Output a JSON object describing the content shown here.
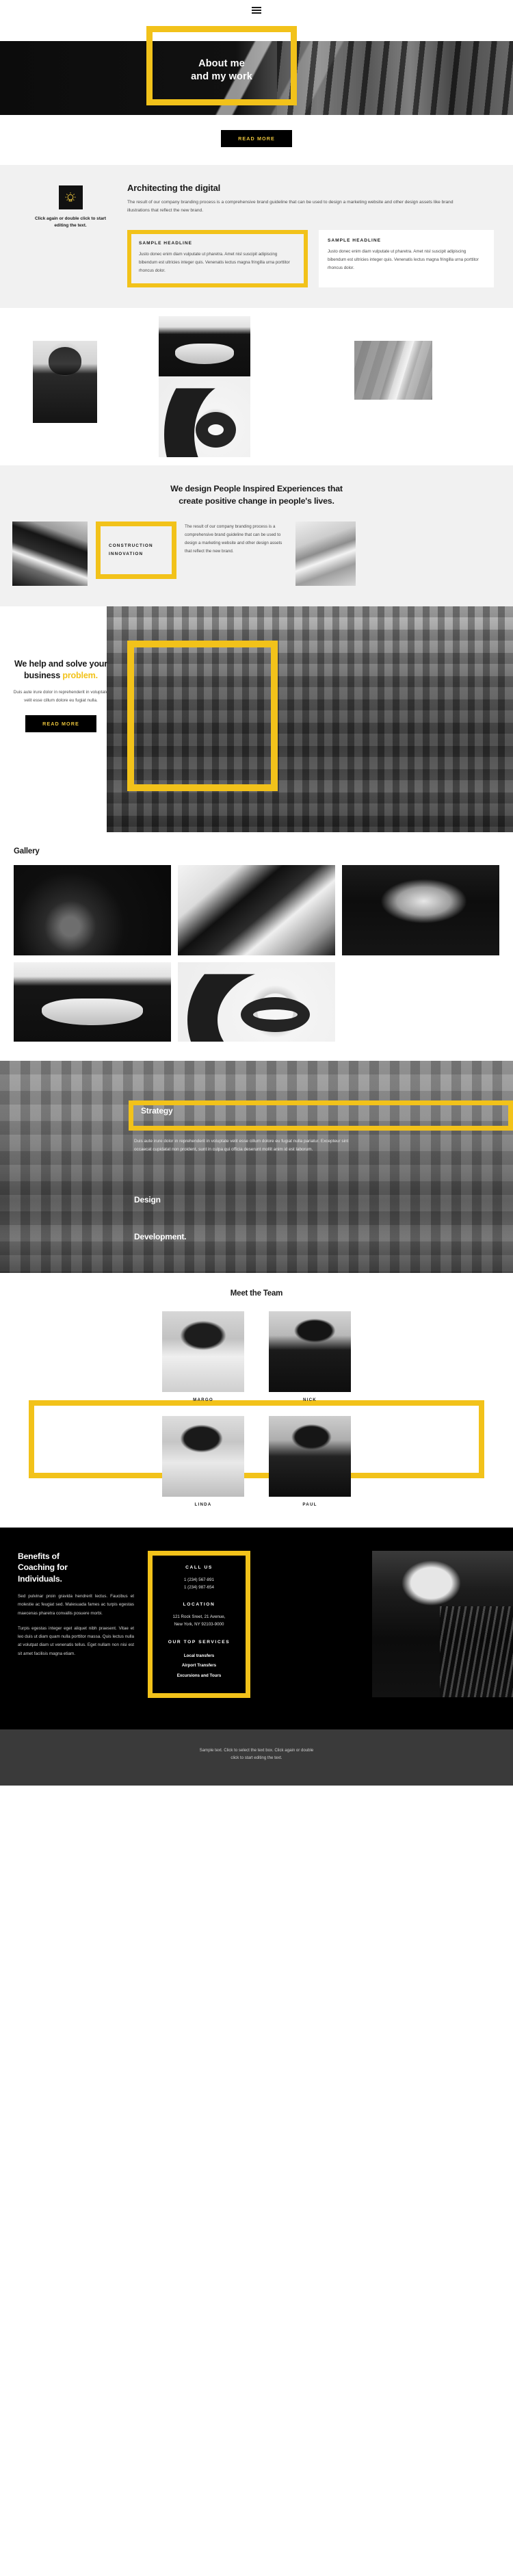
{
  "nav": {
    "menu_icon": "hamburger-menu-icon"
  },
  "hero": {
    "title_line1": "About me",
    "title_line2": "and my work"
  },
  "read_more": {
    "label": "READ MORE"
  },
  "architecting": {
    "icon": "lightbulb-icon",
    "note": "Click again or double click to start editing the text.",
    "heading": "Architecting the digital",
    "paragraph": "The result of our company branding process is a comprehensive brand guideline that can be used to design a marketing website and other design assets like brand illustrations that reflect the new brand.",
    "cards": [
      {
        "headline": "SAMPLE HEADLINE",
        "body": "Justo donec enim diam vulputate ut pharetra. Amet nisl suscipit adipiscing bibendum est ultricies integer quis. Venenatis lectus magna fringilla urna porttitor rhoncus dolor."
      },
      {
        "headline": "SAMPLE HEADLINE",
        "body": "Justo donec enim diam vulputate ut pharetra. Amet nisl suscipit adipiscing bibendum est ultricies integer quis. Venenatis lectus magna fringilla urna porttitor rhoncus dolor."
      }
    ]
  },
  "collage": {
    "image_1": "woman-in-black-coat-photo",
    "image_2": "folded-hands-photo",
    "image_3": "spiral-staircase-photo",
    "image_4": "beach-shoreline-photo"
  },
  "design": {
    "heading_line1": "We design People Inspired Experiences that",
    "heading_line2": "create positive change in people's lives.",
    "image_left": "architecture-ceiling-photo",
    "frame_label_line1": "CONSTRUCTION",
    "frame_label_line2": "INNOVATION",
    "paragraph": "The result of our company branding process is a comprehensive brand guideline that can be used to design a marketing website and other design assets that reflect the new brand.",
    "image_right": "white-architecture-photo"
  },
  "help": {
    "heading_line1": "We help and solve your",
    "heading_line2_plain": "business ",
    "heading_line2_accent": "problem.",
    "paragraph": "Duis aute irure dolor in reprehenderit in voluptate velit esse cillum dolore eu fugiat nulla.",
    "button_label": "READ MORE",
    "image": "aerial-traffic-highway-photo"
  },
  "gallery": {
    "heading": "Gallery",
    "items": [
      "ear-closeup-photo",
      "white-cloth-hands-photo",
      "woman-portrait-dark-photo",
      "hands-detail-photo",
      "spiral-staircase-photo"
    ]
  },
  "strategy": {
    "label": "Strategy",
    "paragraph": "Duis aute irure dolor in reprehenderit in voluptate velit esse cillum dolore eu fugiat nulla pariatur. Excepteur sint occaecat cupidatat non proident, sunt in culpa qui officia deserunt mollit anim id est laborum.",
    "item_2": "Design",
    "item_3": "Development.",
    "image": "city-street-cyclist-photo"
  },
  "team": {
    "heading": "Meet the Team",
    "members": [
      {
        "name": "MARGO",
        "photo": "margo-portrait-photo"
      },
      {
        "name": "NICK",
        "photo": "nick-portrait-photo"
      },
      {
        "name": "LINDA",
        "photo": "linda-portrait-photo"
      },
      {
        "name": "PAUL",
        "photo": "paul-portrait-photo"
      }
    ]
  },
  "benefits": {
    "heading_line1": "Benefits of",
    "heading_line2": "Coaching for",
    "heading_line3": "Individuals.",
    "paragraph_1": "Sed pulvinar proin gravida hendrerit lectus. Faucibus et molestie ac feugiat sed. Malesuada fames ac turpis egestas maecenas pharetra convallis posuere morbi.",
    "paragraph_2": "Turpis egestas integer eget aliquet nibh praesent. Vitae et leo duis ut diam quam nulla porttitor massa. Quis lectus nulla at volutpat diam ut venenatis tellus. Eget nullam non nisi est sit amet facilisis magna etiam.",
    "call_us_title": "CALL US",
    "phone_1": "1 (234) 567-891",
    "phone_2": "1 (234) 987-654",
    "location_title": "LOCATION",
    "address_1": "121 Rock Sreet, 21 Avenue,",
    "address_2": "New York, NY 92103-9000",
    "services_title": "OUR TOP SERVICES",
    "services": [
      "Local transfers",
      "Airport Transfers",
      "Excursions and Tours"
    ],
    "image": "woman-in-suit-photo"
  },
  "footer": {
    "text_line1": "Sample text. Click to select the text box. Click again or double",
    "text_line2": "click to start editing the text."
  },
  "colors": {
    "accent": "#f2c21a",
    "dark": "#000000",
    "light_section": "#f1f1f1",
    "footer_bg": "#3a3a3a"
  }
}
